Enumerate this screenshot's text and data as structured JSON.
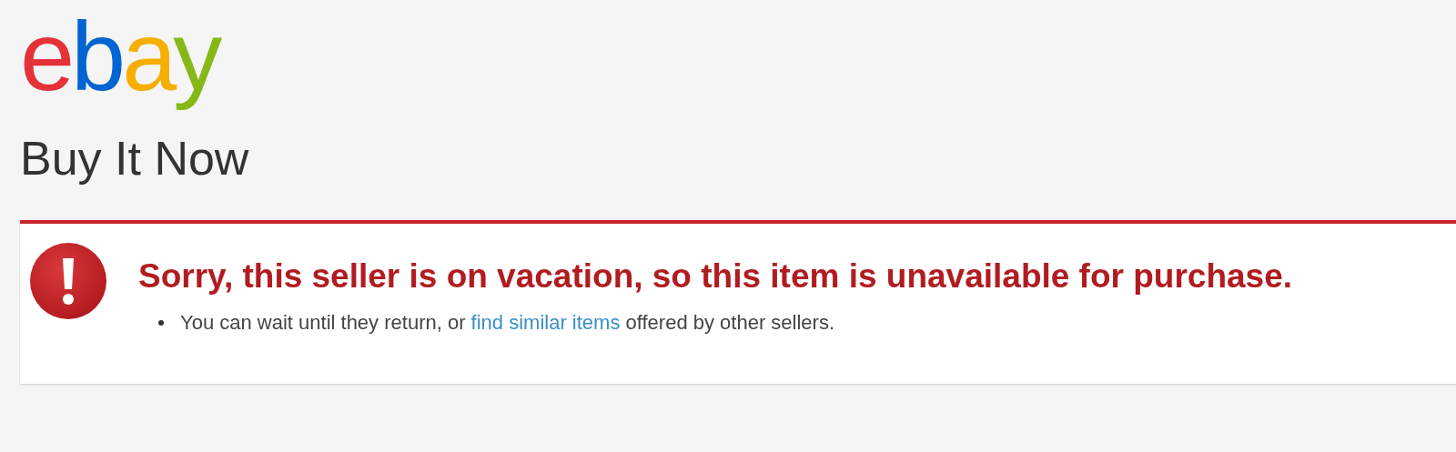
{
  "logo": {
    "letters": [
      {
        "char": "e",
        "color": "#e53238"
      },
      {
        "char": "b",
        "color": "#0064d2"
      },
      {
        "char": "a",
        "color": "#f5af02"
      },
      {
        "char": "y",
        "color": "#86b817"
      }
    ]
  },
  "page_title": "Buy It Now",
  "alert": {
    "title": "Sorry, this seller is on vacation, so this item is unavailable for purchase.",
    "items": [
      {
        "before": "You can wait until they return, or ",
        "link": "find similar items",
        "after": " offered by other sellers."
      }
    ]
  }
}
